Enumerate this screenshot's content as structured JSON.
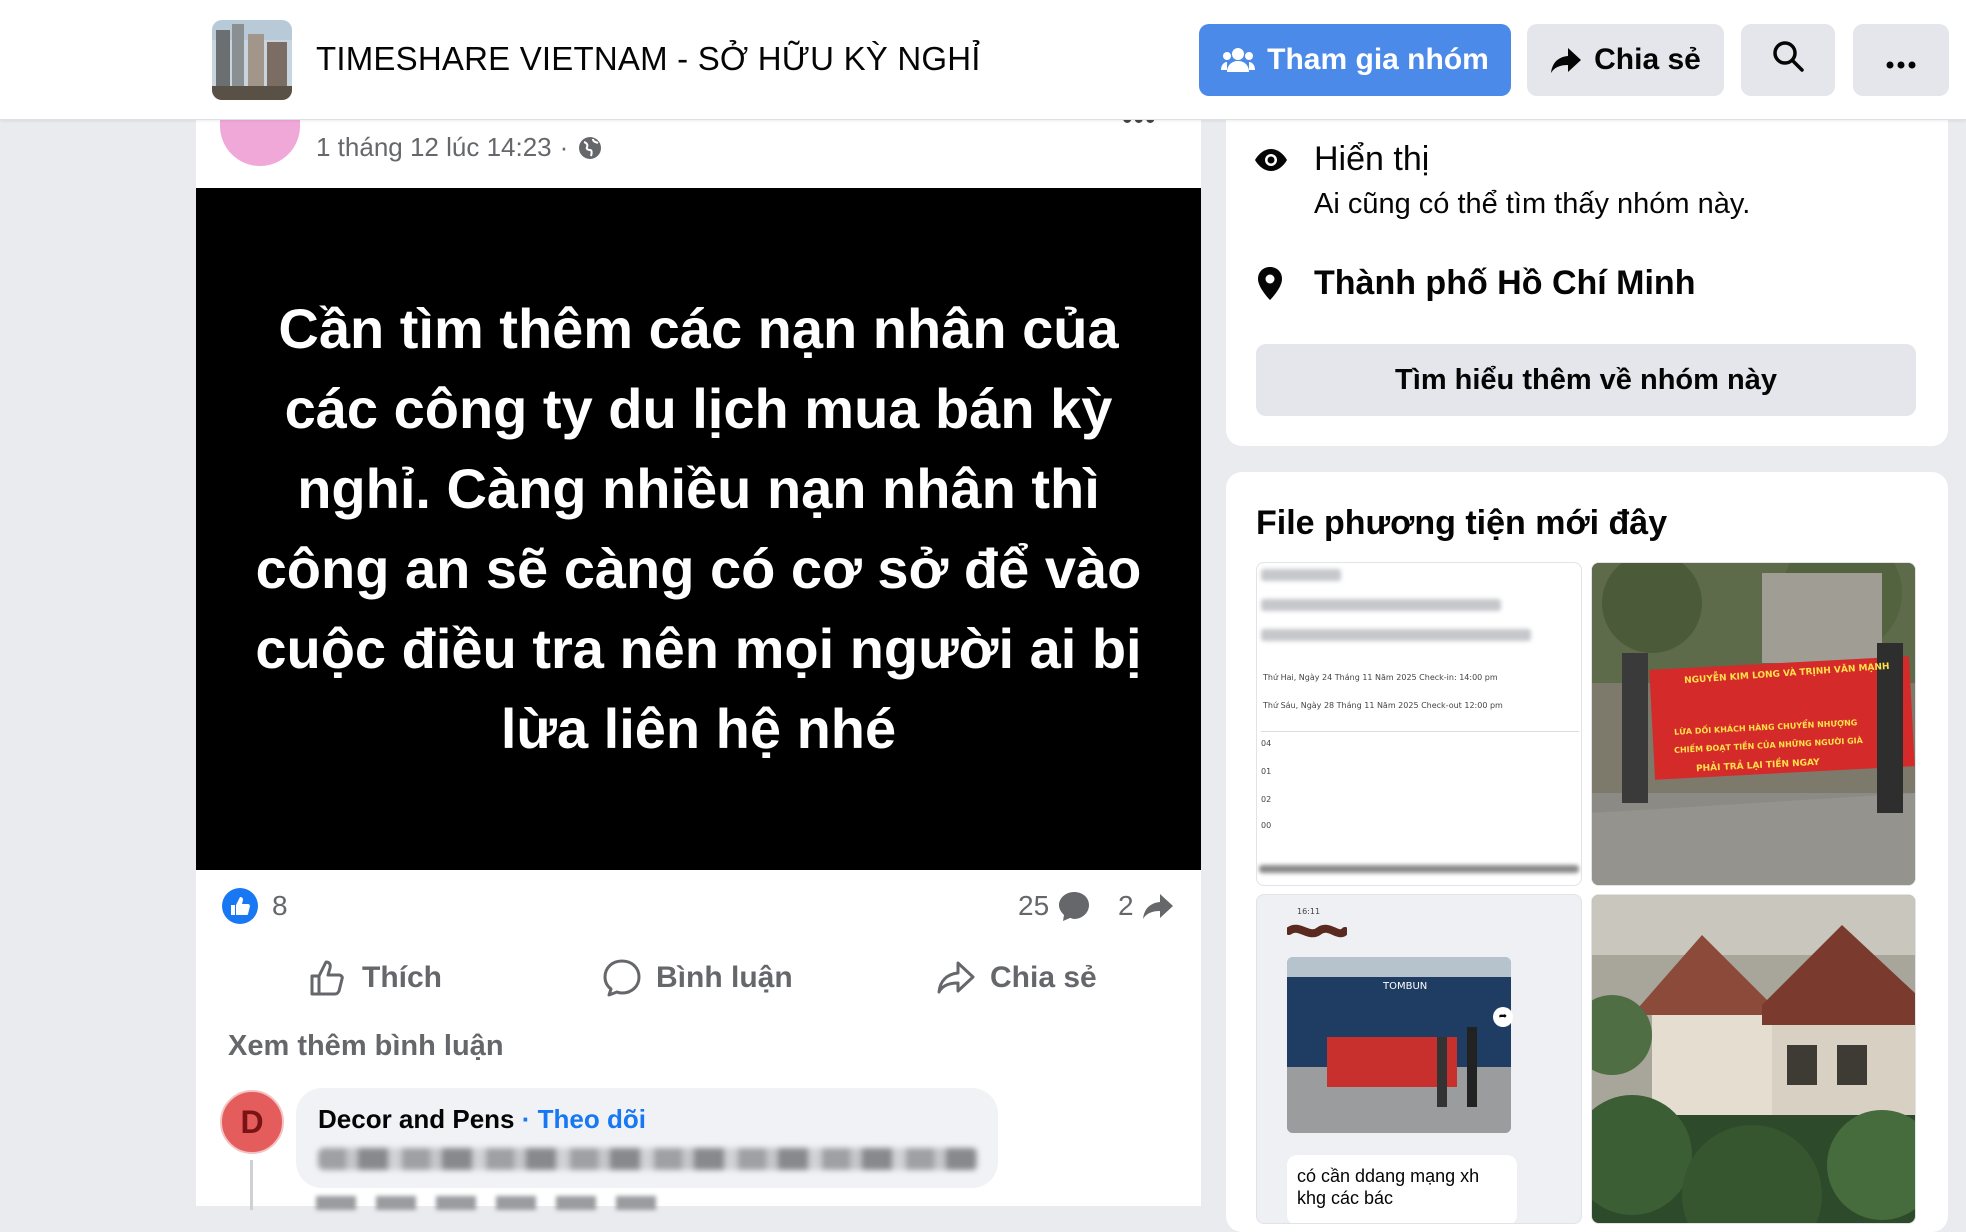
{
  "header": {
    "group_name": "TIMESHARE VIETNAM - SỞ HỮU KỲ NGHỈ",
    "join_label": "Tham gia nhóm",
    "share_label": "Chia sẻ",
    "accent_color": "#4b8ae8"
  },
  "post": {
    "timestamp": "1 tháng 12 lúc 14:23",
    "separator": "·",
    "image_text": "Cần tìm thêm các nạn nhân của các công ty du lịch mua bán kỳ nghỉ. Càng nhiều nạn nhân thì công an sẽ càng có cơ sở để vào cuộc điều tra nên mọi người ai bị lừa liên hệ nhé",
    "reaction_count": "8",
    "comment_count": "25",
    "share_count": "2",
    "actions": {
      "like": "Thích",
      "comment": "Bình luận",
      "share": "Chia sẻ"
    },
    "more_comments": "Xem thêm bình luận",
    "comment": {
      "avatar_letter": "D",
      "author": "Decor and Pens",
      "follow_separator": "·",
      "follow_label": "Theo dõi"
    }
  },
  "about": {
    "visibility_title": "Hiển thị",
    "visibility_desc": "Ai cũng có thể tìm thấy nhóm này.",
    "location": "Thành phố Hồ Chí Minh",
    "learn_more": "Tìm hiểu thêm về nhóm này"
  },
  "media": {
    "title": "File phương tiện mới đây",
    "thumb1": {
      "line1": "Thứ Hai, Ngày 24 Tháng 11 Năm 2025 Check-in: 14:00 pm",
      "line2": "Thứ Sáu, Ngày 28 Tháng 11 Năm 2025 Check-out 12:00 pm",
      "rows": [
        "04",
        "01",
        "02",
        "00"
      ]
    },
    "thumb2": {
      "banner_top": "NGUYỄN KIM LONG VÀ TRỊNH VĂN MẠNH",
      "banner_line1": "LỪA DỐI KHÁCH HÀNG CHUYỂN NHƯỢNG",
      "banner_line2": "CHIẾM ĐOẠT TIỀN CỦA NHỮNG NGƯỜI GIÀ",
      "banner_line3": "PHẢI TRẢ LẠI TIỀN NGAY"
    },
    "thumb3": {
      "store_sign": "TOMBUN",
      "time": "16:11",
      "caption": "có cần ddang mạng xh khg các bác"
    }
  }
}
